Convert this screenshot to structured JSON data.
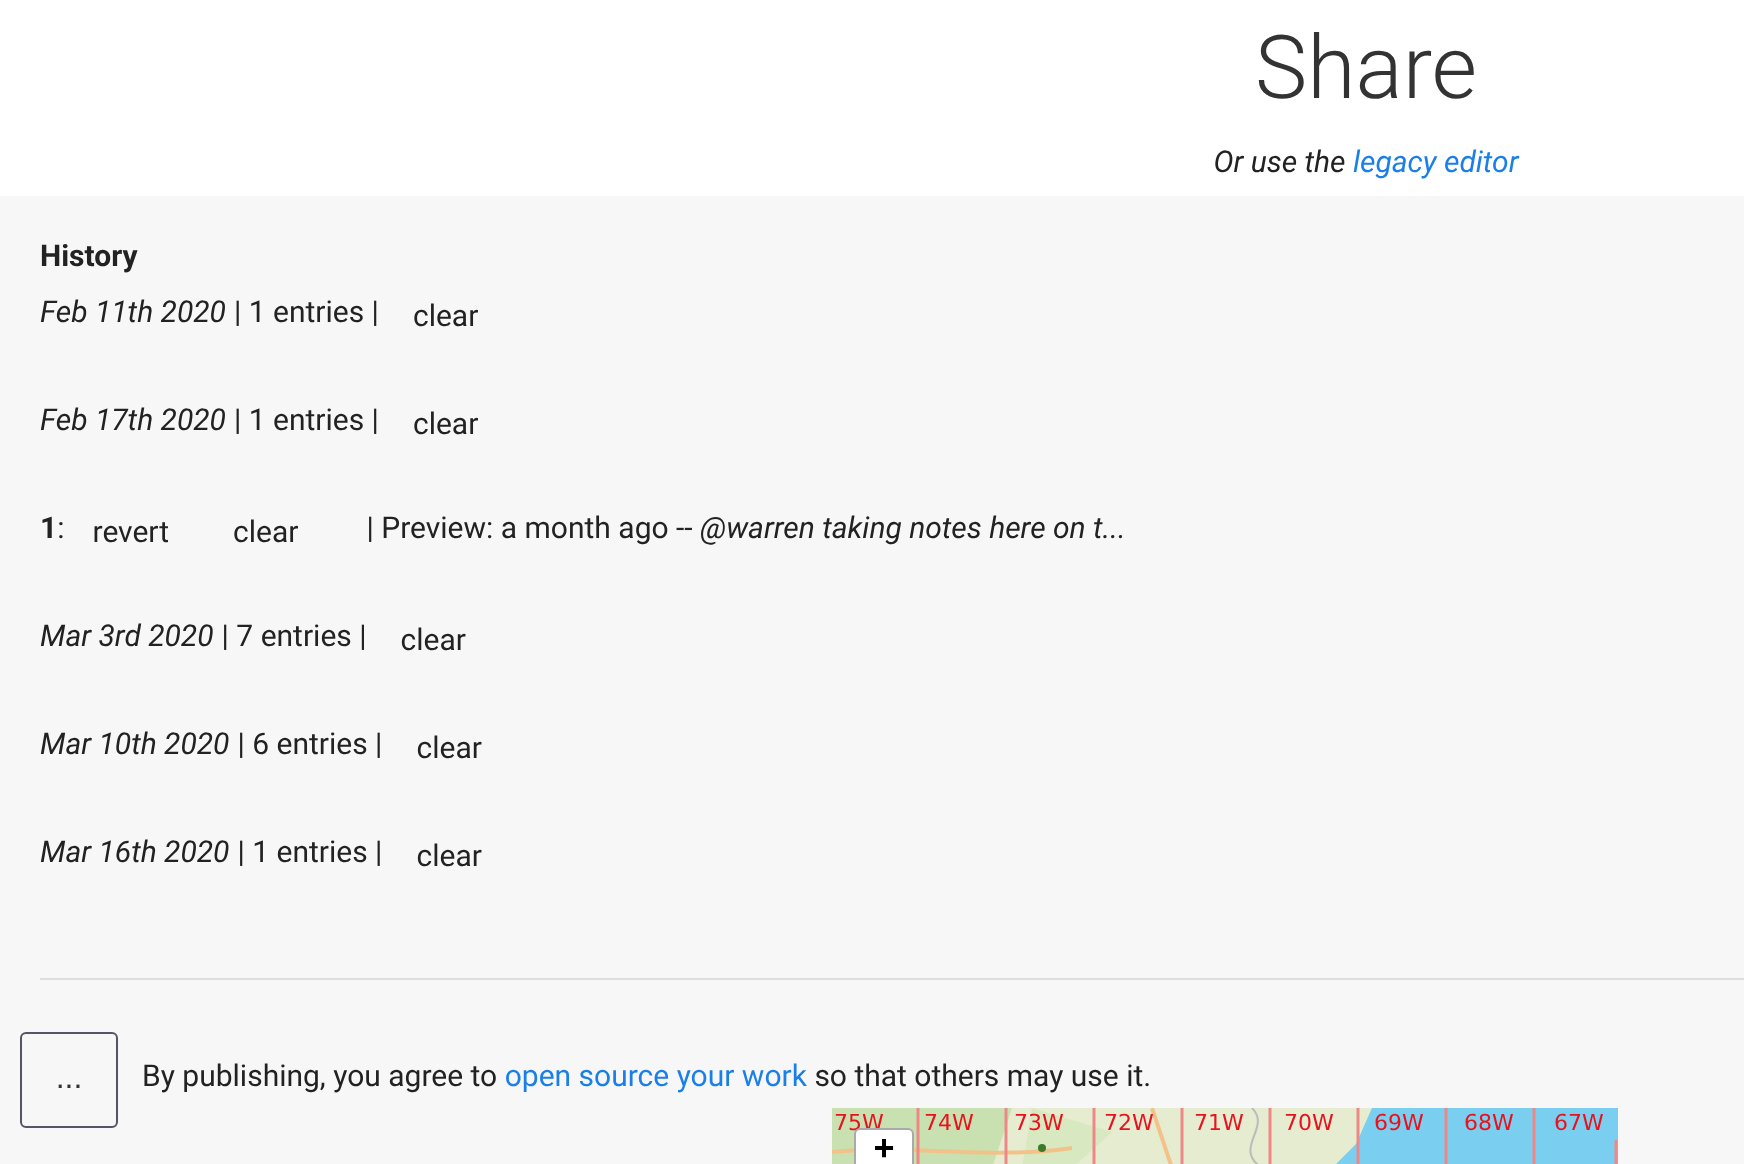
{
  "header": {
    "title": "Share",
    "subtitle": "Or use the",
    "subtitle_link": "legacy editor"
  },
  "history": {
    "title": "History",
    "rows": [
      {
        "kind": "day",
        "date": "Feb 11th 2020",
        "count": "| 1 entries |",
        "action": "clear"
      },
      {
        "kind": "day",
        "date": "Feb 17th 2020",
        "count": "| 1 entries |",
        "action": "clear"
      },
      {
        "kind": "entry",
        "index": "1",
        "sep": ":",
        "revert": "revert",
        "action": "clear",
        "preview": "| Preview: a month ago -- *@warren taking notes here on t...*"
      },
      {
        "kind": "day",
        "date": "Mar 3rd 2020",
        "count": "| 7 entries |",
        "action": "clear"
      },
      {
        "kind": "day",
        "date": "Mar 10th 2020",
        "count": "| 6 entries |",
        "action": "clear"
      },
      {
        "kind": "day",
        "date": "Mar 16th 2020",
        "count": "| 1 entries |",
        "action": "clear"
      }
    ]
  },
  "publish": {
    "menu_button": "...",
    "text_before": "By publishing, you agree to",
    "link": "open source your work",
    "text_after": "so that others may use it."
  },
  "map": {
    "zoom_in": "+",
    "grid_labels": [
      "75W",
      "74W",
      "73W",
      "72W",
      "71W",
      "70W",
      "69W",
      "68W",
      "67W"
    ]
  }
}
